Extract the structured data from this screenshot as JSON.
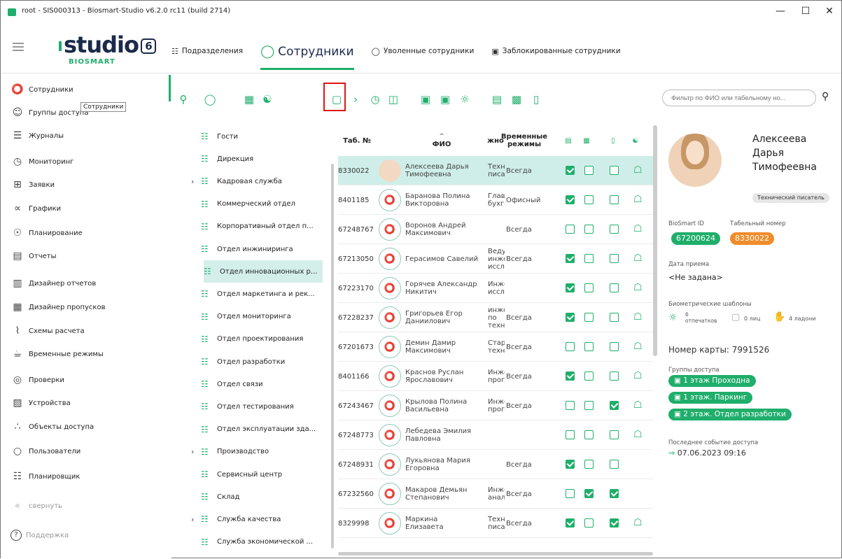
{
  "window": {
    "title": "root - SIS000313 - Biosmart-Studio v6.2.0 rc11 (build 2714)"
  },
  "logo": {
    "word": "studio",
    "version": "6",
    "sub": "BIOSMART"
  },
  "topnav": [
    {
      "label": "Подразделения",
      "icon": "org-icon"
    },
    {
      "label": "Сотрудники",
      "icon": "person-icon"
    },
    {
      "label": "Уволенные сотрудники",
      "icon": "person-x-icon"
    },
    {
      "label": "Заблокированные сотрудники",
      "icon": "lock-icon"
    }
  ],
  "sidebar": [
    {
      "label": "Сотрудники",
      "icon": "person-icon"
    },
    {
      "label": "Группы доступа",
      "icon": "group-icon"
    },
    {
      "label": "Журналы",
      "icon": "journal-icon"
    },
    {
      "label": "Мониторинг",
      "icon": "monitor-icon"
    },
    {
      "label": "Заявки",
      "icon": "request-icon"
    },
    {
      "label": "Графики",
      "icon": "graph-icon"
    },
    {
      "label": "Планирование",
      "icon": "plan-icon"
    },
    {
      "label": "Отчеты",
      "icon": "report-icon"
    },
    {
      "label": "Дизайнер отчетов",
      "icon": "report-designer-icon"
    },
    {
      "label": "Дизайнер пропусков",
      "icon": "pass-designer-icon"
    },
    {
      "label": "Схемы расчета",
      "icon": "scheme-icon"
    },
    {
      "label": "Временные режимы",
      "icon": "time-mode-icon"
    },
    {
      "label": "Проверки",
      "icon": "check-icon"
    },
    {
      "label": "Устройства",
      "icon": "device-icon"
    },
    {
      "label": "Объекты доступа",
      "icon": "object-icon"
    },
    {
      "label": "Пользователи",
      "icon": "user-icon"
    },
    {
      "label": "Планировщик",
      "icon": "scheduler-icon"
    }
  ],
  "collapse_label": "свернуть",
  "support_label": "Поддержка",
  "tooltip": "Сотрудники",
  "filter": {
    "placeholder": "Фильтр по ФИО или табельному но..."
  },
  "departments": [
    {
      "label": "Гости",
      "expandable": false
    },
    {
      "label": "Дирекция",
      "expandable": false
    },
    {
      "label": "Кадровая служба",
      "expandable": true
    },
    {
      "label": "Коммерческий отдел",
      "expandable": false
    },
    {
      "label": "Корпоративный отдел п...",
      "expandable": false
    },
    {
      "label": "Отдел инжиниринга",
      "expandable": false
    },
    {
      "label": "Отдел инновационных р...",
      "expandable": false,
      "selected": true
    },
    {
      "label": "Отдел маркетинга и рек...",
      "expandable": false
    },
    {
      "label": "Отдел мониторинга",
      "expandable": false
    },
    {
      "label": "Отдел проектирования",
      "expandable": false
    },
    {
      "label": "Отдел разработки",
      "expandable": false
    },
    {
      "label": "Отдел связи",
      "expandable": false
    },
    {
      "label": "Отдел тестирования",
      "expandable": false
    },
    {
      "label": "Отдел эксплуатации зда...",
      "expandable": false
    },
    {
      "label": "Производство",
      "expandable": true
    },
    {
      "label": "Сервисный центр",
      "expandable": false
    },
    {
      "label": "Склад",
      "expandable": false
    },
    {
      "label": "Служба качества",
      "expandable": true
    },
    {
      "label": "Служба экономической ...",
      "expandable": false
    }
  ],
  "table": {
    "headers": {
      "tab": "Таб. №",
      "fio": "ФИО",
      "pos": "жно",
      "rej": "Временные режимы"
    },
    "rows": [
      {
        "tab": "8330022",
        "fio": "Алексеева Дарья Тимофеевна",
        "pos": "Техн писат",
        "rej": "Всегда",
        "c": [
          1,
          0,
          0
        ],
        "lock": true,
        "photo": true,
        "sel": true
      },
      {
        "tab": "8401185",
        "fio": "Баранова Полина Викторовна",
        "pos": "Главн бухгал",
        "rej": "Офисный центр",
        "c": [
          1,
          0,
          0
        ],
        "lock": true
      },
      {
        "tab": "67248767",
        "fio": "Воронов Андрей Максимович",
        "pos": "",
        "rej": "Всегда",
        "c": [
          0,
          0,
          0
        ],
        "lock": true
      },
      {
        "tab": "67213050",
        "fio": "Герасимов Савелий",
        "pos": "Веду инже иссл",
        "rej": "Всегда",
        "c": [
          1,
          0,
          0
        ],
        "lock": true
      },
      {
        "tab": "67223170",
        "fio": "Горячев Александр Никитич",
        "pos": "Инже иссл",
        "rej": "",
        "c": [
          1,
          0,
          0
        ],
        "lock": true
      },
      {
        "tab": "67228237",
        "fio": "Григорьев Егор Даниилович",
        "pos": "инже по техн",
        "rej": "Всегда",
        "c": [
          1,
          0,
          0
        ],
        "lock": true
      },
      {
        "tab": "67201673",
        "fio": "Демин Дамир Максимович",
        "pos": "Стар техн",
        "rej": "Всегда",
        "c": [
          0,
          0,
          0
        ],
        "lock": true
      },
      {
        "tab": "8401166",
        "fio": "Краснов Руслан Ярославович",
        "pos": "Инже прог",
        "rej": "Всегда",
        "c": [
          1,
          0,
          0
        ],
        "lock": true
      },
      {
        "tab": "67243467",
        "fio": "Крылова Полина Васильевна",
        "pos": "Инже прог",
        "rej": "Всегда",
        "c": [
          0,
          0,
          1
        ],
        "lock": true
      },
      {
        "tab": "67248773",
        "fio": "Лебедева Эмилия Павловна",
        "pos": "",
        "rej": "",
        "c": [
          0,
          0,
          0
        ],
        "lock": true
      },
      {
        "tab": "67248931",
        "fio": "Лукьянова Мария Егоровна",
        "pos": "",
        "rej": "Всегда",
        "c": [
          1,
          0,
          0
        ],
        "lock": false,
        "three": true
      },
      {
        "tab": "67232560",
        "fio": "Макаров Демьян Степанович",
        "pos": "Инже анал",
        "rej": "Всегда",
        "c": [
          0,
          1,
          1
        ],
        "lock": false
      },
      {
        "tab": "8329998",
        "fio": "Маркина Елизавета",
        "pos": "Техн писат",
        "rej": "Всегда",
        "c": [
          1,
          0,
          1
        ],
        "lock": true
      }
    ]
  },
  "details": {
    "name_line1": "Алексеева",
    "name_line2": "Дарья",
    "name_line3": "Тимофеевна",
    "position": "Технический писатель",
    "biosmart_id_label": "BioSmart ID",
    "biosmart_id": "67200624",
    "tab_label": "Табельный номер",
    "tab": "8330022",
    "hire_label": "Дата приема",
    "hire": "<Не задана>",
    "bio_label": "Биометрические шаблоны",
    "fingers_count": "6",
    "fingers_label": "отпечатков",
    "faces": "0 лиц",
    "palms": "4 ладони",
    "card": "Номер карты: 7991526",
    "groups_label": "Группы доступа",
    "groups": [
      "1 этаж Проходна",
      "1 этаж. Паркинг",
      "2 этаж. Отдел разработки"
    ],
    "last_label": "Последнее событие доступа",
    "last": "07.06.2023 09:16"
  },
  "colors": {
    "accent": "#1fae6b",
    "orange": "#f08c2a",
    "highlight": "#e01515"
  }
}
